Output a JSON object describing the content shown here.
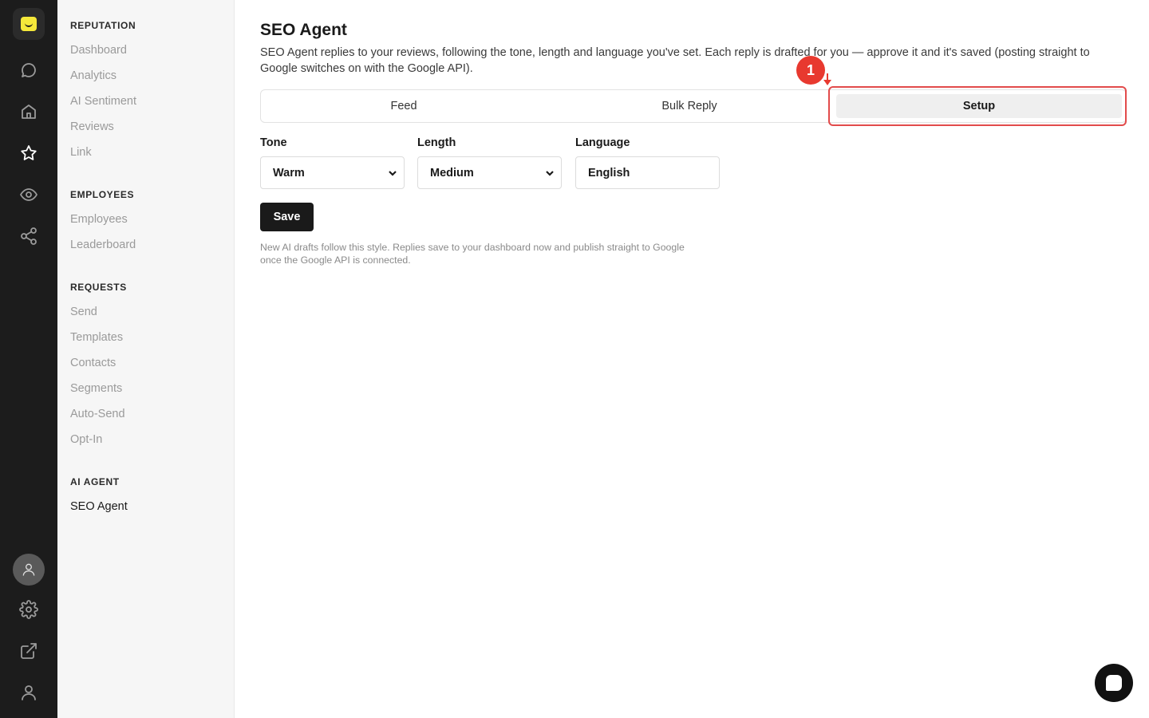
{
  "sidebar": {
    "sections": [
      {
        "title": "REPUTATION",
        "items": [
          "Dashboard",
          "Analytics",
          "AI Sentiment",
          "Reviews",
          "Link"
        ]
      },
      {
        "title": "EMPLOYEES",
        "items": [
          "Employees",
          "Leaderboard"
        ]
      },
      {
        "title": "REQUESTS",
        "items": [
          "Send",
          "Templates",
          "Contacts",
          "Segments",
          "Auto-Send",
          "Opt-In"
        ]
      },
      {
        "title": "AI AGENT",
        "items": [
          "SEO Agent"
        ]
      }
    ],
    "active_item": "SEO Agent"
  },
  "rail": {
    "icons": [
      "logo-icon",
      "chat-icon",
      "home-icon",
      "star-icon",
      "eye-icon",
      "share-icon",
      "avatar-icon",
      "settings-icon",
      "external-link-icon",
      "user-icon"
    ],
    "active": "star-icon"
  },
  "page": {
    "title": "SEO Agent",
    "description": "SEO Agent replies to your reviews, following the tone, length and language you've set. Each reply is drafted for you — approve it and it's saved (posting straight to Google switches on with the Google API)."
  },
  "tabs": [
    {
      "label": "Feed"
    },
    {
      "label": "Bulk Reply"
    },
    {
      "label": "Setup"
    }
  ],
  "active_tab": "Setup",
  "annotation": {
    "number": "1"
  },
  "form": {
    "tone": {
      "label": "Tone",
      "value": "Warm"
    },
    "length": {
      "label": "Length",
      "value": "Medium"
    },
    "language": {
      "label": "Language",
      "value": "English"
    },
    "save_label": "Save",
    "hint": "New AI drafts follow this style. Replies save to your dashboard now and publish straight to Google once the Google API is connected."
  },
  "colors": {
    "rail_bg": "#1c1c1c",
    "sidebar_bg": "#f6f6f6",
    "accent_yellow": "#f5e83a",
    "highlight_red": "#e24b4b"
  }
}
